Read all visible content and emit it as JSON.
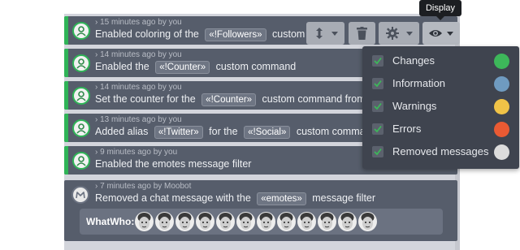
{
  "feed": {
    "entries": [
      {
        "meta": "› 15 minutes ago by you",
        "parts": [
          "Enabled coloring of the ",
          "«!Followers»",
          " custom co"
        ]
      },
      {
        "meta": "› 14 minutes ago by you",
        "parts": [
          "Enabled the ",
          "«!Counter»",
          " custom command"
        ]
      },
      {
        "meta": "› 14 minutes ago by you",
        "parts": [
          "Set the counter for the ",
          "«!Counter»",
          " custom command from "
        ]
      },
      {
        "meta": "› 13 minutes ago by you",
        "parts": [
          "Added alias ",
          "«!Twitter»",
          " for the ",
          "«!Social»",
          " custom command"
        ]
      },
      {
        "meta": "› 9 minutes ago by you",
        "parts": [
          "Enabled the emotes message filter"
        ]
      },
      {
        "meta": "› 7 minutes ago by Moobot",
        "parts": [
          "Removed a chat message with the ",
          "«emotes»",
          " message filter"
        ]
      }
    ],
    "emote_label": "WhatWho:",
    "emote_count": 12,
    "bar_color": "#2fb457"
  },
  "toolbar": {
    "sort_icon": "sort-arrows-icon",
    "delete_icon": "trash-icon",
    "settings_icon": "gear-icon",
    "display_icon": "eye-icon"
  },
  "tooltip": {
    "text": "Display"
  },
  "display_menu": {
    "items": [
      {
        "label": "Changes",
        "checked": true,
        "color": "#3db75a"
      },
      {
        "label": "Information",
        "checked": true,
        "color": "#6f9bc0"
      },
      {
        "label": "Warnings",
        "checked": true,
        "color": "#f0c347"
      },
      {
        "label": "Errors",
        "checked": true,
        "color": "#ea5a33"
      },
      {
        "label": "Removed messages",
        "checked": true,
        "color": "#dcdcdc"
      }
    ]
  }
}
